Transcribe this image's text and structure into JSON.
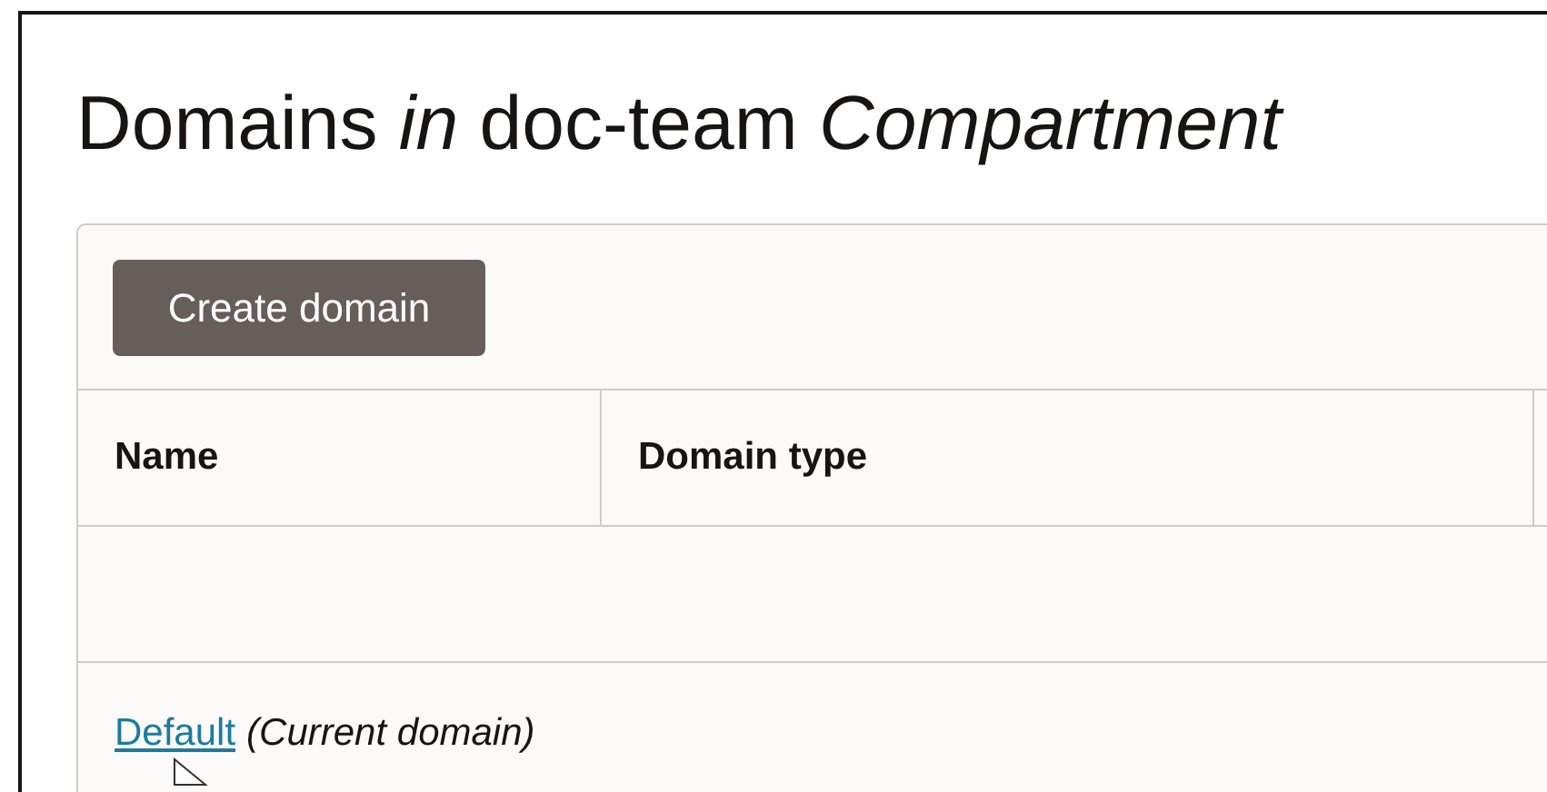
{
  "page": {
    "title": "Domains *in* doc-team *Compartment*"
  },
  "toolbar": {
    "button": "Create domain"
  },
  "table": {
    "columns": [
      "Name",
      "Domain type"
    ],
    "rows": [
      {
        "name": "Default",
        "note": "(Current domain)"
      }
    ]
  }
}
